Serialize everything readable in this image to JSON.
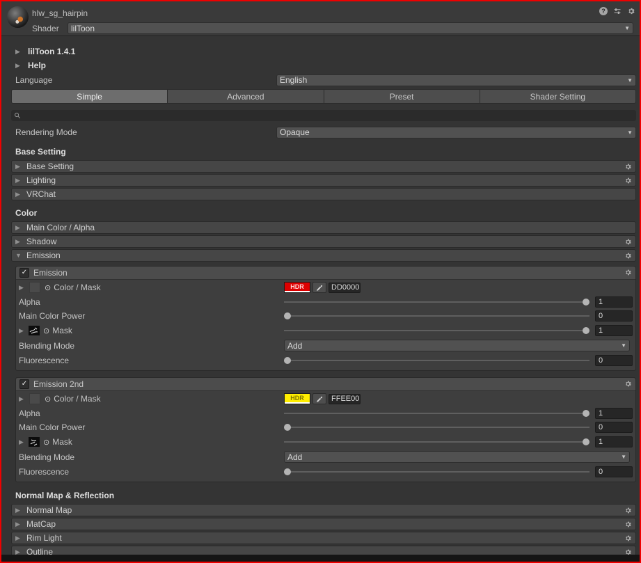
{
  "window": {
    "title": "hlw_sg_hairpin",
    "shader_label": "Shader",
    "shader_value": "lilToon"
  },
  "icons": {
    "help": "?",
    "foldout_collapsed": "▶",
    "foldout_expanded": "▼",
    "dropdown_arrow": "▼",
    "object_picker": "⊙",
    "checkmark": "✓",
    "search": "magnifier",
    "gear": "gear",
    "preset": "mixer-sliders",
    "eyedropper": "pipette"
  },
  "general": {
    "version": "lilToon 1.4.1",
    "help": "Help",
    "language_label": "Language",
    "language_value": "English"
  },
  "tabs": {
    "items": [
      {
        "label": "Simple",
        "selected": true
      },
      {
        "label": "Advanced",
        "selected": false
      },
      {
        "label": "Preset",
        "selected": false
      },
      {
        "label": "Shader Setting",
        "selected": false
      }
    ]
  },
  "search": {
    "placeholder": ""
  },
  "rendering": {
    "label": "Rendering Mode",
    "value": "Opaque"
  },
  "base_setting": {
    "heading": "Base Setting",
    "rows": [
      {
        "label": "Base Setting",
        "gear": true
      },
      {
        "label": "Lighting",
        "gear": true
      },
      {
        "label": "VRChat",
        "gear": false
      }
    ]
  },
  "color": {
    "heading": "Color",
    "rows": [
      {
        "label": "Main Color / Alpha",
        "gear": false,
        "expanded": false
      },
      {
        "label": "Shadow",
        "gear": true,
        "expanded": false
      },
      {
        "label": "Emission",
        "gear": true,
        "expanded": true
      }
    ],
    "emission1": {
      "title": "Emission",
      "enabled": true,
      "color_mask_label": "Color / Mask",
      "hdr_badge": "HDR",
      "hdr_color": "#dd0000",
      "hex_value": "DD0000",
      "alpha_label": "Alpha",
      "alpha_value": "1",
      "main_color_power_label": "Main Color Power",
      "main_color_power_value": "0",
      "mask_label": "Mask",
      "mask_value": "1",
      "blending_label": "Blending Mode",
      "blending_value": "Add",
      "fluorescence_label": "Fluorescence",
      "fluorescence_value": "0"
    },
    "emission2": {
      "title": "Emission 2nd",
      "enabled": true,
      "color_mask_label": "Color / Mask",
      "hdr_badge": "HDR",
      "hdr_color": "#ffee00",
      "hex_value": "FFEE00",
      "alpha_label": "Alpha",
      "alpha_value": "1",
      "main_color_power_label": "Main Color Power",
      "main_color_power_value": "0",
      "mask_label": "Mask",
      "mask_value": "1",
      "blending_label": "Blending Mode",
      "blending_value": "Add",
      "fluorescence_label": "Fluorescence",
      "fluorescence_value": "0"
    }
  },
  "normal_reflection": {
    "heading": "Normal Map & Reflection",
    "rows": [
      {
        "label": "Normal Map",
        "gear": true
      },
      {
        "label": "MatCap",
        "gear": true
      },
      {
        "label": "Rim Light",
        "gear": true
      },
      {
        "label": "Outline",
        "gear": true
      }
    ]
  }
}
